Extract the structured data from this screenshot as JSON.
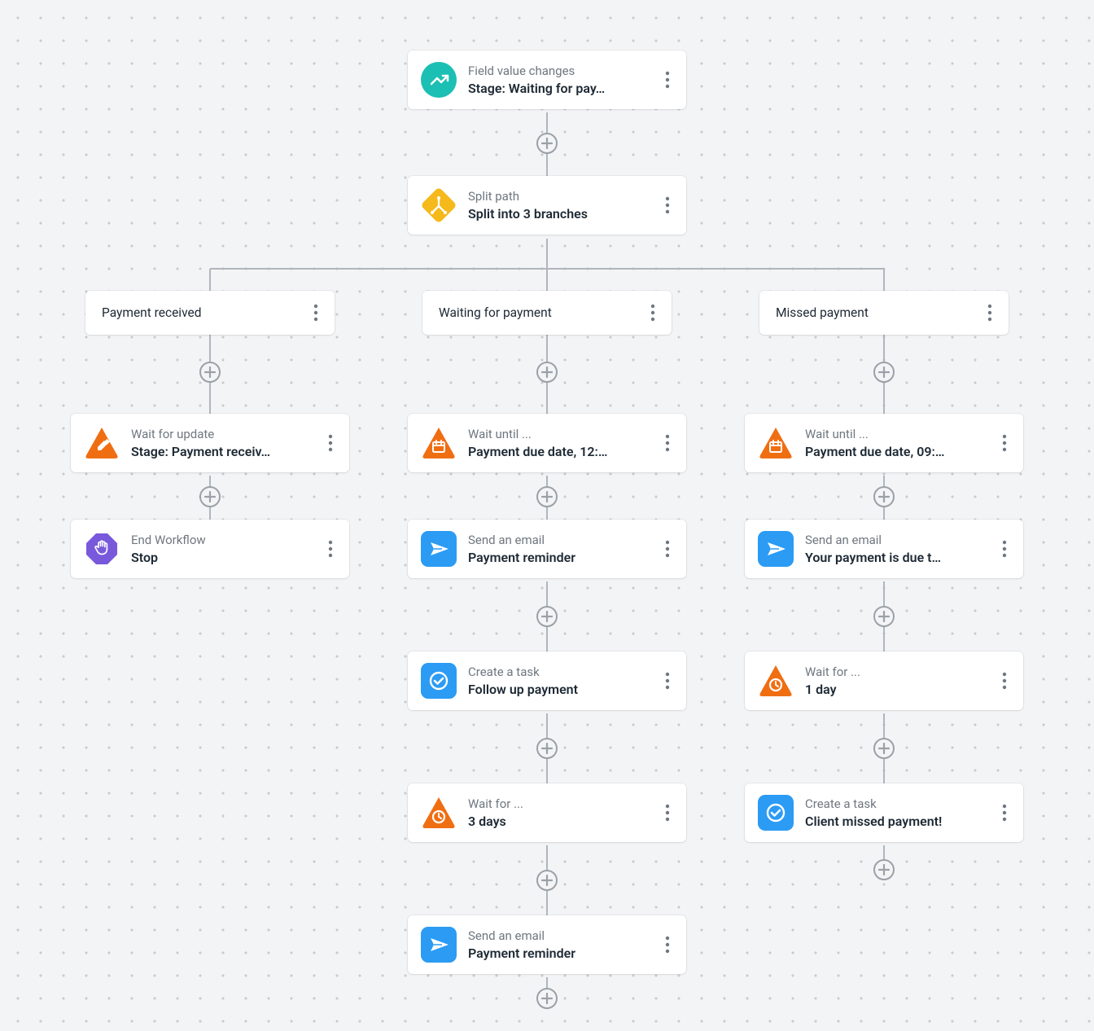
{
  "trigger": {
    "title": "Field value changes",
    "detail": "Stage: Waiting for pay…"
  },
  "split": {
    "title": "Split path",
    "detail": "Split into 3 branches"
  },
  "branches": [
    {
      "label": "Payment received",
      "steps": [
        {
          "icon": "tri-pencil",
          "title": "Wait for update",
          "detail": "Stage: Payment receiv…"
        },
        {
          "icon": "hex-hand",
          "title": "End Workflow",
          "detail": "Stop"
        }
      ]
    },
    {
      "label": "Waiting for payment",
      "steps": [
        {
          "icon": "tri-calendar",
          "title": "Wait until ...",
          "detail": "Payment due date, 12:…"
        },
        {
          "icon": "sq-send",
          "title": "Send an email",
          "detail": "Payment reminder"
        },
        {
          "icon": "sq-check",
          "title": "Create a task",
          "detail": "Follow up payment"
        },
        {
          "icon": "tri-clock",
          "title": "Wait for ...",
          "detail": "3 days"
        },
        {
          "icon": "sq-send",
          "title": "Send an email",
          "detail": "Payment reminder"
        }
      ]
    },
    {
      "label": "Missed payment",
      "steps": [
        {
          "icon": "tri-calendar",
          "title": "Wait until ...",
          "detail": "Payment due date, 09:…"
        },
        {
          "icon": "sq-send",
          "title": "Send an email",
          "detail": "Your payment is due t…"
        },
        {
          "icon": "tri-clock",
          "title": "Wait for ...",
          "detail": "1 day"
        },
        {
          "icon": "sq-check",
          "title": "Create a task",
          "detail": "Client missed payment!"
        }
      ]
    }
  ]
}
